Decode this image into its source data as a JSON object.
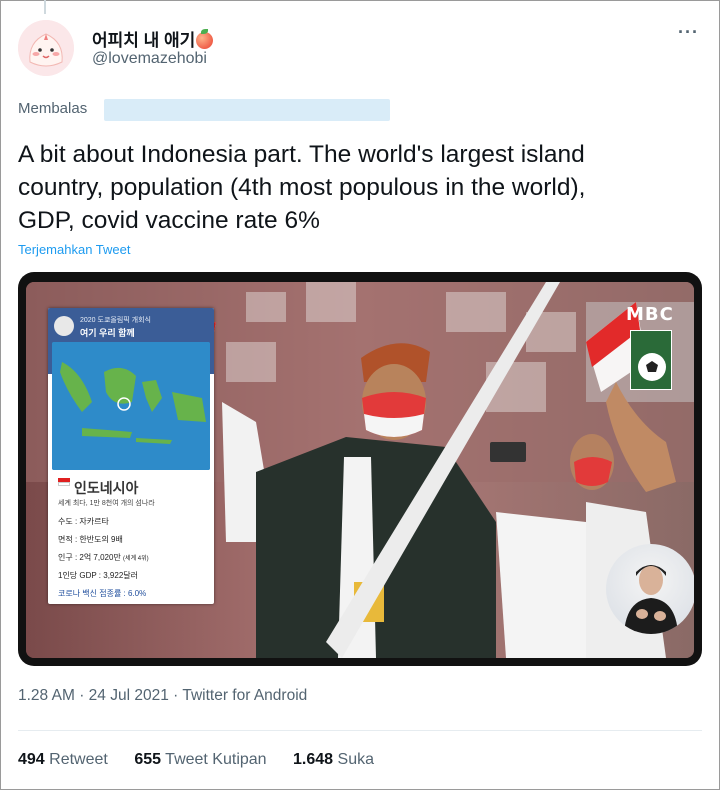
{
  "author": {
    "name": "어피치 내 애기",
    "handle": "@lovemazehobi",
    "avatar_icon": "apeach-character-icon",
    "name_emoji_icon": "peach-icon"
  },
  "more_label": "···",
  "reply": {
    "prefix": "Membalas"
  },
  "tweet_text": "A bit about Indonesia part. The world's largest island\ncountry, population (4th most populous in the world),\nGDP, covid vaccine rate 6%",
  "translate_label": "Terjemahkan Tweet",
  "media": {
    "tv_logo": "MBC",
    "overlay": {
      "event": "2020 도쿄올림픽 개회식",
      "subtitle": "여기 우리 함께",
      "country": "인도네시아",
      "description": "세계 최다, 1만 8천여 개의 섬나라",
      "rows": [
        {
          "label": "수도 : 자카르타"
        },
        {
          "label": "면적 : 한반도의 9배"
        },
        {
          "label": "인구 : 2억 7,020만"
        },
        {
          "label": "1인당 GDP : 3,922달러"
        },
        {
          "label": "코로나 백신 접종률 : 6.0%"
        }
      ],
      "population_note": "(세계 4위)"
    }
  },
  "meta": {
    "time": "1.28 AM",
    "date": "24 Jul 2021",
    "source": "Twitter for Android",
    "separator": "·"
  },
  "stats": [
    {
      "count": "494",
      "label": "Retweet"
    },
    {
      "count": "655",
      "label": "Tweet Kutipan"
    },
    {
      "count": "1.648",
      "label": "Suka"
    }
  ],
  "colors": {
    "link": "#1d9bf0",
    "secondary_text": "#536471",
    "primary_text": "#0f1419"
  }
}
